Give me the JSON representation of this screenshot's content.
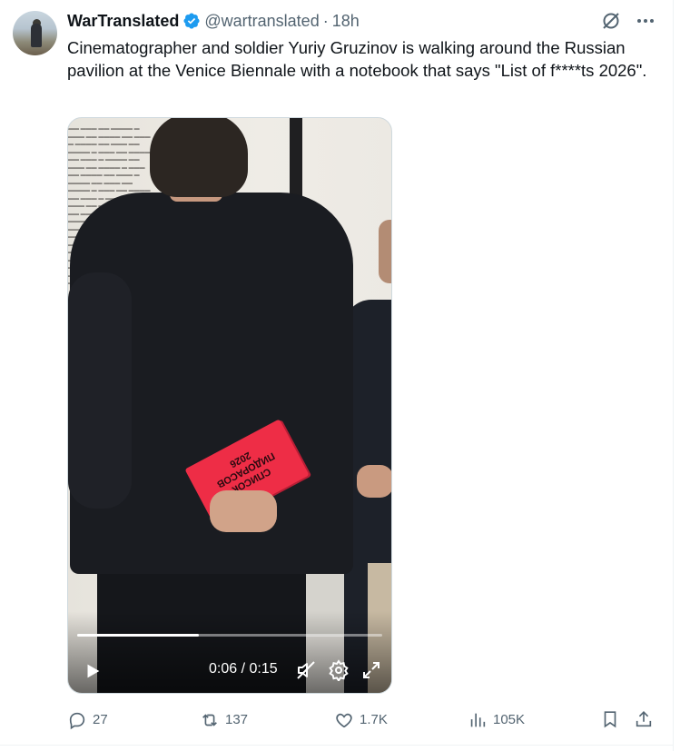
{
  "author": {
    "display_name": "WarTranslated",
    "handle": "@wartranslated",
    "separator": "·",
    "time": "18h",
    "verified": true
  },
  "tweet": {
    "text": "Cinematographer and soldier Yuriy Gruzinov is walking around the Russian pavilion at the Venice Biennale with a notebook that says \"List of f****ts 2026\"."
  },
  "header_icons": [
    "grok-icon",
    "more-icon"
  ],
  "media": {
    "type": "video",
    "current_time": "0:06",
    "duration": "0:15",
    "time_readout": "0:06 / 0:15",
    "progress": 0.4,
    "muted": true
  },
  "actions": {
    "replies": "27",
    "reposts": "137",
    "likes": "1.7K",
    "views": "105K"
  },
  "colors": {
    "verified_badge": "#1d9bf0",
    "secondary_text": "#536471",
    "primary_text": "#0f1419",
    "notebook": "#ee2d46"
  }
}
